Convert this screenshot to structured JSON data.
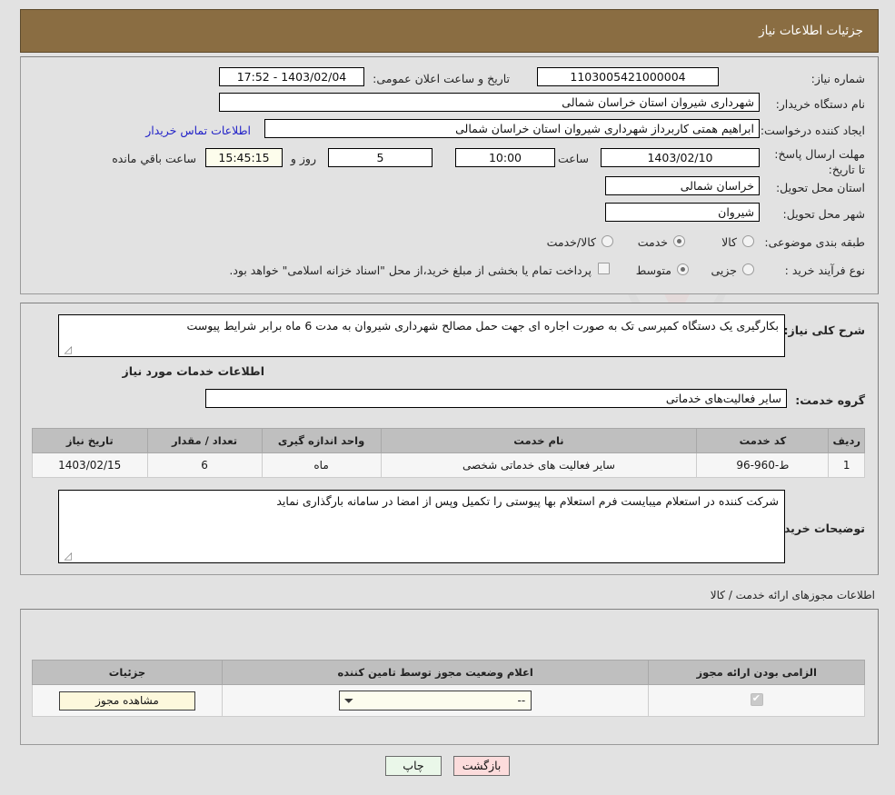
{
  "header": {
    "title": "جزئیات اطلاعات نیاز",
    "bg_color": "#8a6d42"
  },
  "main": {
    "need_number_label": "شماره نیاز:",
    "need_number_value": "1103005421000004",
    "announce_label": "تاریخ و ساعت اعلان عمومی:",
    "announce_value": "17:52 - 1403/02/04",
    "buyer_org_label": "نام دستگاه خریدار:",
    "buyer_org_value": "شهرداری شیروان استان خراسان شمالی",
    "creator_label": "ایجاد کننده درخواست:",
    "creator_value": "ابراهیم همتی کاربرداز شهرداری شیروان استان خراسان شمالی",
    "contact_link": "اطلاعات تماس خریدار",
    "deadline_label": "مهلت ارسال پاسخ: تا تاریخ:",
    "deadline_date": "1403/02/10",
    "hour_label": "ساعت",
    "hour_value": "10:00",
    "days_value": "5",
    "days_label": "روز و",
    "remaining_value": "15:45:15",
    "remaining_label": "ساعت باقي مانده",
    "province_label": "استان محل تحویل:",
    "province_value": "خراسان شمالی",
    "city_label": "شهر محل تحویل:",
    "city_value": "شیروان",
    "category_label": "طبقه بندی موضوعی:",
    "category_options": [
      {
        "label": "کالا",
        "selected": false
      },
      {
        "label": "خدمت",
        "selected": true
      },
      {
        "label": "کالا/خدمت",
        "selected": false
      }
    ],
    "process_label": "نوع فرآیند خرید :",
    "process_options": [
      {
        "label": "جزیی",
        "selected": false
      },
      {
        "label": "متوسط",
        "selected": true
      }
    ],
    "treasury_checkbox_checked": false,
    "treasury_note": "پرداخت تمام یا بخشی از مبلغ خرید،از محل \"اسناد خزانه اسلامی\" خواهد بود."
  },
  "description": {
    "need_summary_label": "شرح کلی نیاز:",
    "need_summary_value": "بکارگیری یک دستگاه کمپرسی تک به صورت اجاره ای جهت حمل مصالح شهرداری شیروان به مدت 6 ماه برابر شرایط پیوست",
    "services_info_heading": "اطلاعات خدمات مورد نیاز",
    "service_group_label": "گروه خدمت:",
    "service_group_value": "سایر فعالیت‌های خدماتی",
    "buyer_notes_label": "توضیحات خریدار:",
    "buyer_notes_value": "شرکت کننده در استعلام میبایست فرم استعلام بها پیوستی را تکمیل وپس از امضا در سامانه بارگذاری نماید"
  },
  "services_table": {
    "columns": [
      "ردیف",
      "کد خدمت",
      "نام خدمت",
      "واحد اندازه گیری",
      "تعداد / مقدار",
      "تاریخ نیاز"
    ],
    "rows": [
      [
        "1",
        "ط-960-96",
        "سایر فعالیت های خدماتی شخصی",
        "ماه",
        "6",
        "1403/02/15"
      ]
    ]
  },
  "permits": {
    "heading": "اطلاعات مجوزهای ارائه خدمت / کالا",
    "columns": [
      "الزامی بودن ارائه مجوز",
      "اعلام وضعیت مجوز توسط تامین کننده",
      "جزئیات"
    ],
    "rows": [
      {
        "required_checked": true,
        "status_value": "--",
        "status_options": [
          "--"
        ],
        "detail_button": "مشاهده مجوز"
      }
    ]
  },
  "footer": {
    "print_label": "چاپ",
    "back_label": "بازگشت"
  },
  "watermark": {
    "text_left": "Ana",
    "text_mid": "Tender",
    "text_right": ".neT"
  }
}
